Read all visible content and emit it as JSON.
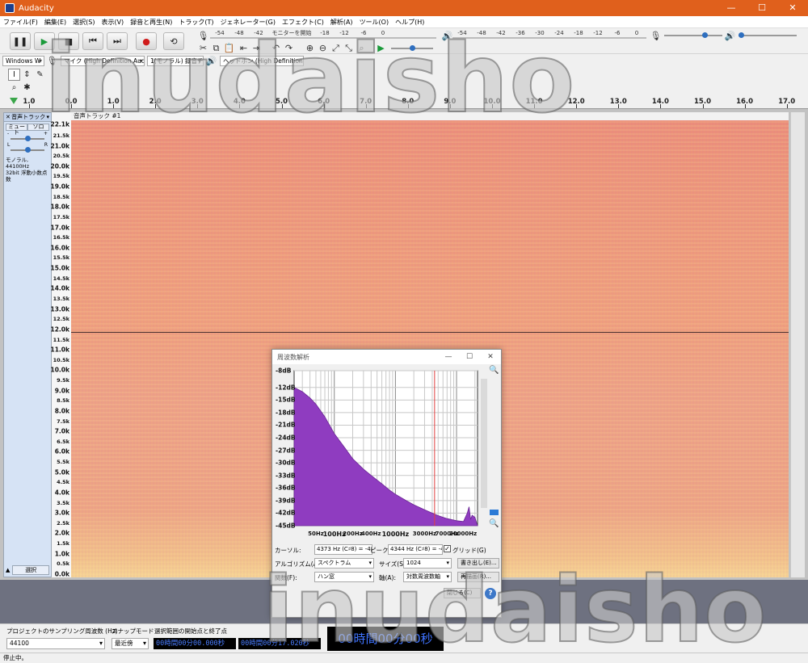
{
  "window": {
    "title": "Audacity",
    "minimize": "—",
    "maximize": "☐",
    "close": "✕"
  },
  "menu": [
    "ファイル(F)",
    "編集(E)",
    "選択(S)",
    "表示(V)",
    "録音と再生(N)",
    "トラック(T)",
    "ジェネレーター(G)",
    "エフェクト(C)",
    "解析(A)",
    "ツール(O)",
    "ヘルプ(H)"
  ],
  "transport": {
    "pause": "❚❚",
    "play": "▶",
    "stop": "■",
    "skip_start": "⏮",
    "skip_end": "⏭",
    "record": "●",
    "loop": "⟲"
  },
  "record_meter": {
    "scale": [
      "-54",
      "-48",
      "-42",
      "モニターを開始",
      "-18",
      "-12",
      "-6",
      "0"
    ]
  },
  "playback_meter": {
    "scale": [
      "-54",
      "-48",
      "-42",
      "-36",
      "-30",
      "-24",
      "-18",
      "-12",
      "-6",
      "0"
    ]
  },
  "edit_icons": [
    "✂",
    "⧉",
    "📋",
    "⇤",
    "⇥",
    "↶",
    "↷",
    "⊕",
    "⊖",
    "⤢",
    "⤡",
    "⌕"
  ],
  "devices": {
    "host": "Windows W",
    "mic": "マイク (High Definition Audio",
    "channels": "1(モノラル) 録音チャ",
    "output": "ヘッドホン (High Definition Au"
  },
  "ruler": {
    "labels": [
      "1.0",
      "0.0",
      "1.0",
      "2.0",
      "3.0",
      "4.0",
      "5.0",
      "6.0",
      "7.0",
      "8.0",
      "9.0",
      "10.0",
      "11.0",
      "12.0",
      "13.0",
      "14.0",
      "15.0",
      "16.0",
      "17.0"
    ],
    "values": [
      -1.0,
      0.0,
      1.0,
      2.0,
      3.0,
      4.0,
      5.0,
      6.0,
      7.0,
      8.0,
      9.0,
      10.0,
      11.0,
      12.0,
      13.0,
      14.0,
      15.0,
      16.0,
      17.0
    ]
  },
  "track": {
    "menu": "音声トラック",
    "close": "✕",
    "mute": "ミュート",
    "solo": "ソロ",
    "gain_minus": "-",
    "gain_plus": "+",
    "pan_left": "L",
    "pan_right": "R",
    "info1": "モノラル, 44100Hz",
    "info2": "32bit 浮動小数点数",
    "select": "選択",
    "collapse": "▲",
    "name": "音声トラック #1"
  },
  "freq_axis": {
    "labels": [
      "22.1k",
      "21.5k",
      "21.0k",
      "20.5k",
      "20.0k",
      "19.5k",
      "19.0k",
      "18.5k",
      "18.0k",
      "17.5k",
      "17.0k",
      "16.5k",
      "16.0k",
      "15.5k",
      "15.0k",
      "14.5k",
      "14.0k",
      "13.5k",
      "13.0k",
      "12.5k",
      "12.0k",
      "11.5k",
      "11.0k",
      "10.5k",
      "10.0k",
      "9.5k",
      "9.0k",
      "8.5k",
      "8.0k",
      "7.5k",
      "7.0k",
      "6.5k",
      "6.0k",
      "5.5k",
      "5.0k",
      "4.5k",
      "4.0k",
      "3.5k",
      "3.0k",
      "2.5k",
      "2.0k",
      "1.5k",
      "1.0k",
      "0.5k",
      "0.0k"
    ],
    "values": [
      22.05,
      21.5,
      21.0,
      20.5,
      20.0,
      19.5,
      19.0,
      18.5,
      18.0,
      17.5,
      17.0,
      16.5,
      16.0,
      15.5,
      15.0,
      14.5,
      14.0,
      13.5,
      13.0,
      12.5,
      12.0,
      11.5,
      11.0,
      10.5,
      10.0,
      9.5,
      9.0,
      8.5,
      8.0,
      7.5,
      7.0,
      6.5,
      6.0,
      5.5,
      5.0,
      4.5,
      4.0,
      3.5,
      3.0,
      2.5,
      2.0,
      1.5,
      1.0,
      0.5,
      0.0
    ]
  },
  "dialog": {
    "title": "周波数解析",
    "cursor_label": "カーソル:",
    "cursor_value": "4373 Hz (C♯8) = -42",
    "peak_label": "ピーク:",
    "peak_value": "4344 Hz (C♯8) = -42",
    "grid_label": "グリッド(G)",
    "grid_checked": "✓",
    "algorithm_label": "アルゴリズム(A):",
    "algorithm_value": "スペクトラム",
    "size_label": "サイズ(S):",
    "size_value": "1024",
    "export_button": "書き出し(E)...",
    "function_label": "関数(F):",
    "function_value": "ハン窓",
    "axis_label": "軸(A):",
    "axis_value": "対数周波数軸",
    "redraw_button": "再描画(R)...",
    "close_button": "閉じる(C)",
    "help": "?",
    "zoom_in": "🔍",
    "zoom_out": "🔍"
  },
  "chart_data": {
    "type": "area",
    "x_scale": "log",
    "xlim": [
      22,
      22050
    ],
    "ylim": [
      -45,
      -8
    ],
    "grid": true,
    "x_tick_labels": [
      "50Hz",
      "100Hz",
      "200Hz",
      "400Hz",
      "1000Hz",
      "3000Hz",
      "7000Hz",
      "20000Hz"
    ],
    "x_tick_values": [
      50,
      100,
      200,
      400,
      1000,
      3000,
      7000,
      20000
    ],
    "y_tick_labels": [
      "-8dB",
      "-12dB",
      "-15dB",
      "-18dB",
      "-21dB",
      "-24dB",
      "-27dB",
      "-30dB",
      "-33dB",
      "-36dB",
      "-39dB",
      "-42dB",
      "-45dB"
    ],
    "y_tick_values": [
      -8,
      -12,
      -15,
      -18,
      -21,
      -24,
      -27,
      -30,
      -33,
      -36,
      -39,
      -42,
      -45
    ],
    "cursor_hz": 4373,
    "x": [
      22,
      30,
      40,
      50,
      70,
      100,
      150,
      200,
      300,
      400,
      600,
      800,
      1000,
      1500,
      2000,
      3000,
      4000,
      5000,
      7000,
      10000,
      13000,
      15000,
      16000,
      17000,
      18000,
      20000,
      22050
    ],
    "y": [
      -12.0,
      -13.0,
      -14.5,
      -16.0,
      -19.0,
      -23.0,
      -26.5,
      -29.0,
      -31.5,
      -33.0,
      -35.0,
      -36.5,
      -37.5,
      -39.0,
      -40.0,
      -41.2,
      -42.0,
      -42.6,
      -43.3,
      -43.8,
      -44.0,
      -42.0,
      -40.5,
      -43.5,
      -42.5,
      -43.0,
      -45.0
    ]
  },
  "selection_bar": {
    "rate_label": "プロジェクトのサンプリング周波数 (Hz)",
    "rate_value": "44100",
    "snap_label": "スナップモード",
    "snap_value": "最近傍",
    "range_label": "選択範囲の開始点と終了点",
    "start_time": "00時間00分00.000秒",
    "end_time": "00時間00分17.020秒",
    "audio_position": "00時間00分00秒"
  },
  "status": "停止中。",
  "watermark": "inudaisho"
}
